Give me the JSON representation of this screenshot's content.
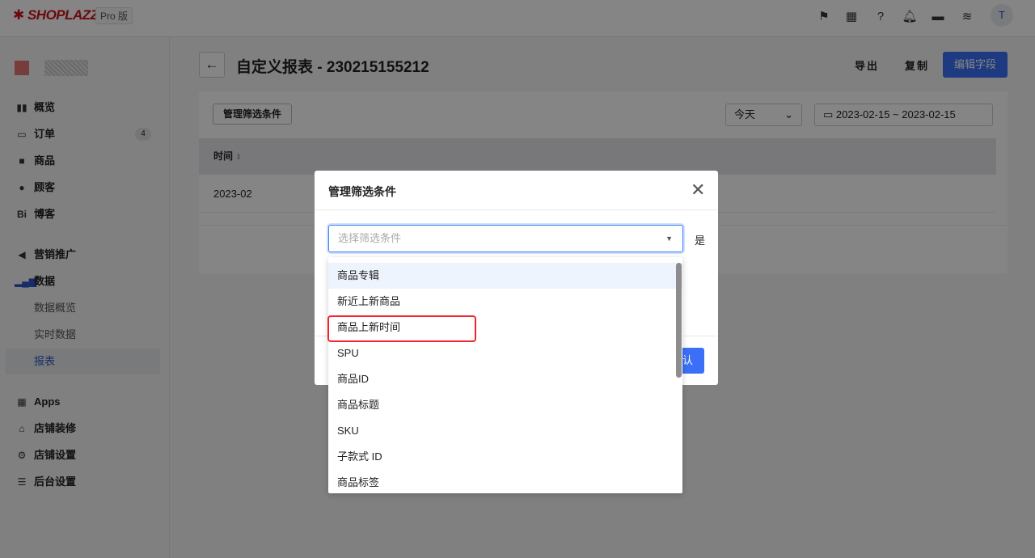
{
  "topbar": {
    "logo": "SHOPLAZZA",
    "edition": "Pro 版",
    "icons": [
      "flag-icon",
      "store-icon",
      "help-icon",
      "bell-icon",
      "message-icon",
      "wifi-icon"
    ],
    "avatar": "T",
    "brand_color": "#d0121b"
  },
  "sidebar": {
    "items": [
      {
        "label": "概览",
        "icon": "dashboard-icon"
      },
      {
        "label": "订单",
        "icon": "inbox-icon",
        "badge": "4"
      },
      {
        "label": "商品",
        "icon": "bag-icon"
      },
      {
        "label": "顾客",
        "icon": "user-icon"
      },
      {
        "label": "博客",
        "icon": "blog-icon"
      },
      {
        "label": "营销推广",
        "icon": "megaphone-icon"
      },
      {
        "label": "数据",
        "icon": "bar-chart-icon"
      },
      {
        "label": "数据概览"
      },
      {
        "label": "实时数据"
      },
      {
        "label": "报表",
        "active": true
      },
      {
        "label": "Apps",
        "icon": "apps-icon"
      },
      {
        "label": "店铺装修",
        "icon": "store-icon"
      },
      {
        "label": "店铺设置",
        "icon": "gear-icon"
      },
      {
        "label": "后台设置",
        "icon": "server-icon"
      }
    ]
  },
  "header": {
    "title": "自定义报表 - 230215155212",
    "export": "导出",
    "copy": "复制",
    "edit_fields": "编辑字段",
    "accent": "#3b6ff5"
  },
  "toolbar": {
    "manage_filters": "管理筛选条件",
    "period": "今天",
    "date_start": "2023-02-15",
    "date_sep": "~",
    "date_end": "2023-02-15"
  },
  "table": {
    "columns": [
      "时间"
    ],
    "rows": [
      [
        "2023-02"
      ]
    ]
  },
  "modal": {
    "title": "管理筛选条件",
    "placeholder": "选择筛选条件",
    "is_label": "是",
    "confirm_partial": "认",
    "options": [
      "商品专辑",
      "新近上新商品",
      "商品上新时间",
      "SPU",
      "商品ID",
      "商品标题",
      "SKU",
      "子款式 ID",
      "商品标签"
    ],
    "highlighted_option": "商品上新时间"
  }
}
